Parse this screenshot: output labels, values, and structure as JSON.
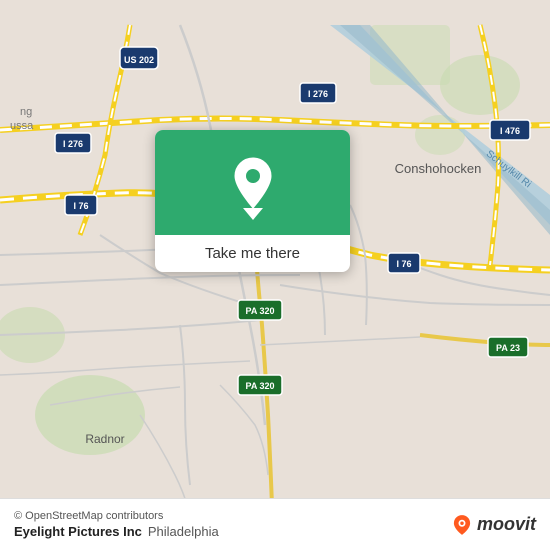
{
  "map": {
    "background_color": "#e8e0d8",
    "center_lat": 40.0459,
    "center_lng": -75.2173
  },
  "popup": {
    "button_label": "Take me there",
    "bg_color": "#2eaa6e",
    "pin_color": "#ffffff"
  },
  "road_labels": [
    {
      "id": "us202",
      "label": "US 202"
    },
    {
      "id": "i276a",
      "label": "I 276"
    },
    {
      "id": "i276b",
      "label": "I 276"
    },
    {
      "id": "i76a",
      "label": "I 76"
    },
    {
      "id": "i76b",
      "label": "I 76"
    },
    {
      "id": "i476",
      "label": "I 476"
    },
    {
      "id": "pa320a",
      "label": "PA 320"
    },
    {
      "id": "pa320b",
      "label": "PA 320"
    },
    {
      "id": "pa23",
      "label": "PA 23"
    }
  ],
  "place_labels": [
    {
      "id": "conshohocken",
      "label": "Conshohocken"
    },
    {
      "id": "radnor",
      "label": "Radnor"
    },
    {
      "id": "russia",
      "label": "ng\nussa"
    }
  ],
  "river_label": "Schuylkill Ri",
  "info_bar": {
    "copyright": "© OpenStreetMap contributors",
    "location_name": "Eyelight Pictures Inc",
    "city": "Philadelphia"
  },
  "moovit": {
    "brand": "moovit",
    "pin_color": "#ff5a1f"
  }
}
